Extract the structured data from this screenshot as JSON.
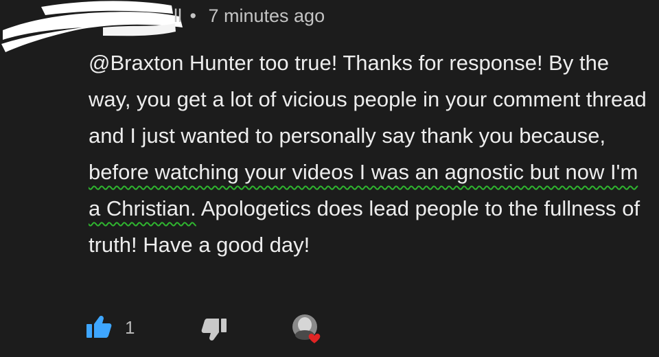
{
  "comment": {
    "author_partial": "ll",
    "separator": "•",
    "timestamp": "7 minutes ago",
    "text_before": "@Braxton Hunter too true! Thanks for response! By the way, you get a lot of vicious people in your comment thread and I just wanted to personally say thank you because, ",
    "text_highlighted": "before watching your videos I was an agnostic but now I'm a Christian.",
    "text_after": " Apologetics does lead people to the fullness of truth! Have a good day!",
    "highlight_color": "#2fb52f"
  },
  "actions": {
    "like_count": "1",
    "like_icon": "thumbs-up-icon",
    "like_color": "#3ea6ff",
    "dislike_icon": "thumbs-down-icon",
    "creator_heart_icon": "creator-heart-icon",
    "heart_color": "#e02424"
  },
  "colors": {
    "background": "#1c1c1c",
    "text": "#ededed",
    "meta_text": "#c4c4c4",
    "redaction": "#ffffff"
  }
}
